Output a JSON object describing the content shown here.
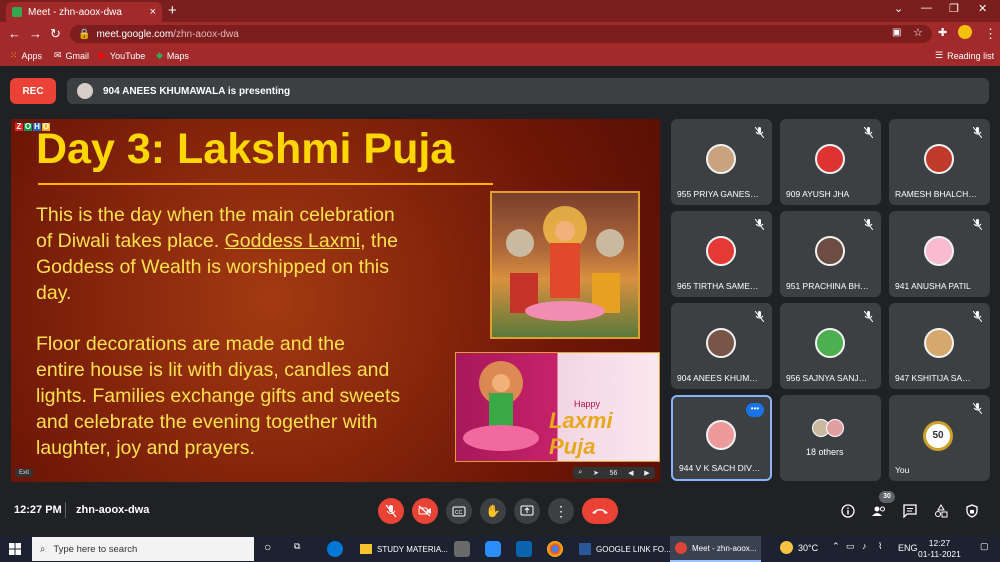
{
  "browser": {
    "tab_title": "Meet - zhn-aoox-dwa",
    "tab_close": "×",
    "newtab": "+",
    "url_host": "meet.google.com",
    "url_path": "/zhn-aoox-dwa",
    "bookmarks": [
      "Apps",
      "Gmail",
      "YouTube",
      "Maps"
    ],
    "reading_list": "Reading list",
    "colors": {
      "frame": "#7a1e1e",
      "toolbar": "#a32a2a"
    }
  },
  "meet": {
    "rec_label": "REC",
    "presenting_text": "904 ANEES KHUMAWALA is presenting",
    "slide": {
      "brand": [
        "Z",
        "O",
        "H",
        "O"
      ],
      "title": "Day 3: Lakshmi Puja",
      "para1_a": "This is the day when the main celebration",
      "para1_b": "of Diwali takes place.",
      "para1_link": "Goddess Laxmi",
      "para1_c": ", the",
      "para1_d": "Goddess of Wealth is worshipped on this",
      "para1_e": "day.",
      "para2_a": "Floor decorations are made and the",
      "para2_b": "entire house is lit with diyas, candles and",
      "para2_c": "lights. Families exchange gifts and sweets",
      "para2_d": "and celebrate the evening together with",
      "para2_e": "laughter, joy and prayers.",
      "card_happy": "Happy",
      "card_puja": "Laxmi Puja",
      "exit_label": "Exit",
      "zoom_level": "56"
    },
    "participants": [
      {
        "name": "955 PRIYA GANES…"
      },
      {
        "name": "909 AYUSH JHA"
      },
      {
        "name": "RAMESH BHALCH…"
      },
      {
        "name": "965 TIRTHA SAME…"
      },
      {
        "name": "951 PRACHINA BH…"
      },
      {
        "name": "941 ANUSHA PATIL"
      },
      {
        "name": "904 ANEES KHUM…"
      },
      {
        "name": "956 SAJNYA SANJ…"
      },
      {
        "name": "947 KSHITIJA SA…"
      },
      {
        "name": "944 V K SACH DIV…"
      }
    ],
    "others_label": "18 others",
    "you_label": "You",
    "you_badge": "50",
    "more_dots": "•••",
    "bottom": {
      "time": "12:27 PM",
      "code": "zhn-aoox-dwa",
      "people_count": "30"
    }
  },
  "taskbar": {
    "search_placeholder": "Type here to search",
    "items": [
      "STUDY MATERIA...",
      "GOOGLE LINK FO...",
      "Meet - zhn-aoox..."
    ],
    "weather": "30°C",
    "lang": "ENG",
    "clock_time": "12:27",
    "clock_date": "01-11-2021"
  }
}
